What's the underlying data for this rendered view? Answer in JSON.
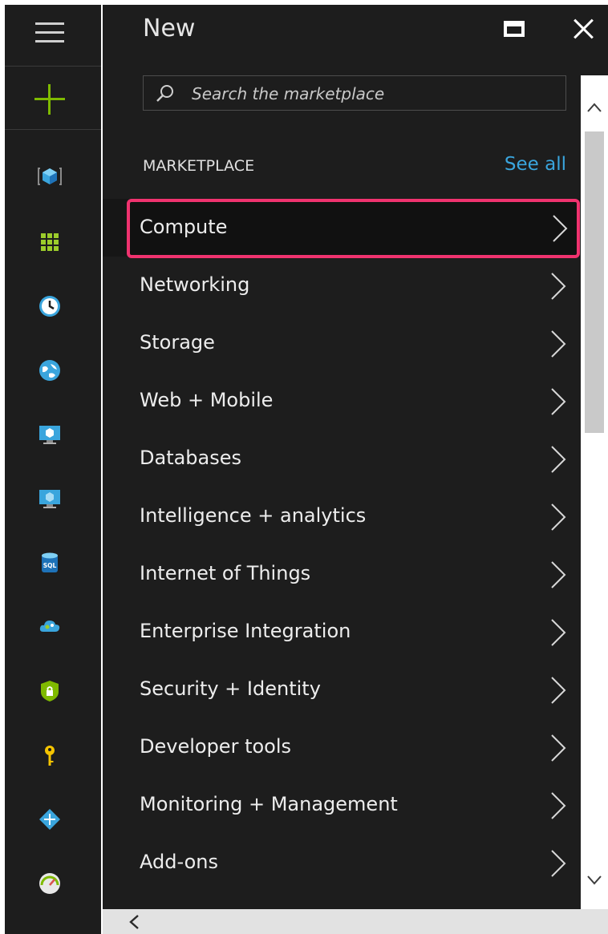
{
  "blade": {
    "title": "New"
  },
  "search": {
    "placeholder": "Search the marketplace"
  },
  "marketplace": {
    "heading": "MARKETPLACE",
    "see_all": "See all",
    "selected_index": 0,
    "items": [
      {
        "label": "Compute"
      },
      {
        "label": "Networking"
      },
      {
        "label": "Storage"
      },
      {
        "label": "Web + Mobile"
      },
      {
        "label": "Databases"
      },
      {
        "label": "Intelligence + analytics"
      },
      {
        "label": "Internet of Things"
      },
      {
        "label": "Enterprise Integration"
      },
      {
        "label": "Security + Identity"
      },
      {
        "label": "Developer tools"
      },
      {
        "label": "Monitoring + Management"
      },
      {
        "label": "Add-ons"
      }
    ]
  },
  "left_rail": {
    "icons": [
      "hamburger-menu-icon",
      "create-plus-icon",
      "resource-groups-cube-icon",
      "all-resources-grid-icon",
      "recent-clock-icon",
      "app-services-globe-icon",
      "virtual-machines-classic-icon",
      "virtual-machines-icon",
      "sql-databases-icon",
      "cloud-services-icon",
      "security-center-shield-icon",
      "key-vault-key-icon",
      "service-fabric-diamond-icon",
      "monitor-gauge-icon"
    ]
  },
  "colors": {
    "background": "#1d1d1d",
    "accent_link": "#3aa5dd",
    "create_plus": "#7fba00",
    "selection_border": "#f0336f"
  }
}
